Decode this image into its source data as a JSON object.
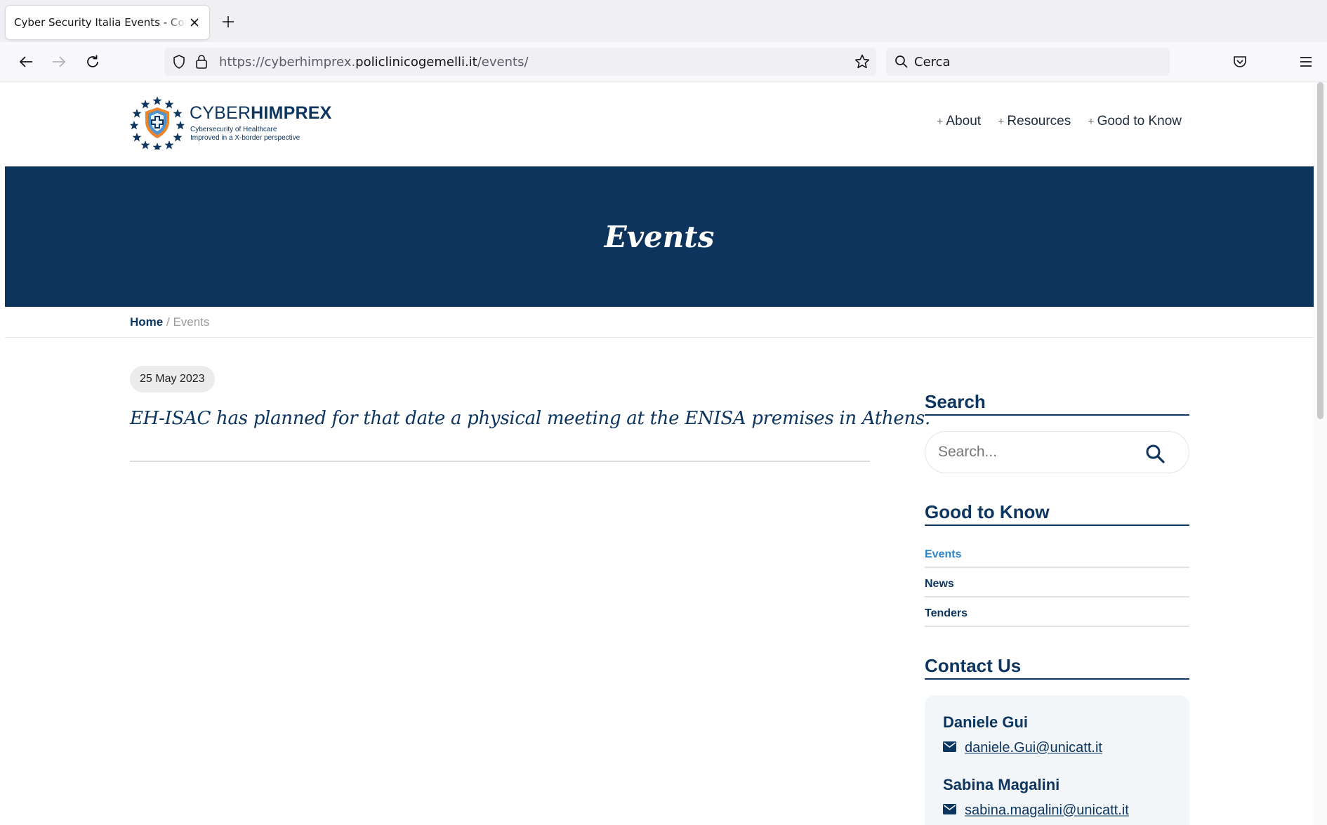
{
  "browser": {
    "tab_title": "Cyber Security Italia Events - Compu",
    "url_prefix": "https://cyberhimprex.",
    "url_host": "policlinicogemelli.it",
    "url_path": "/events/",
    "search_placeholder": "Cerca"
  },
  "site": {
    "logo_word_light": "CYBER",
    "logo_word_bold": "HIMPREX",
    "logo_tagline_1": "Cybersecurity of Healthcare",
    "logo_tagline_2": "Improved in a X-border perspective",
    "nav": [
      {
        "label": "About"
      },
      {
        "label": "Resources"
      },
      {
        "label": "Good to Know"
      }
    ],
    "nav_plus": "+"
  },
  "hero": {
    "title": "Events"
  },
  "breadcrumb": {
    "home": "Home",
    "separator": "/",
    "current": "Events"
  },
  "event": {
    "date": "25 May 2023",
    "title": "EH-ISAC has planned for that date a physical meeting at the ENISA premises in Athens."
  },
  "sidebar": {
    "search_title": "Search",
    "search_placeholder": "Search...",
    "gtk_title": "Good to Know",
    "gtk_items": [
      {
        "label": "Events"
      },
      {
        "label": "News"
      },
      {
        "label": "Tenders"
      }
    ],
    "contact_title": "Contact Us",
    "contacts": [
      {
        "name": "Daniele Gui",
        "email": "daniele.Gui@unicatt.it"
      },
      {
        "name": "Sabina Magalini",
        "email": "sabina.magalini@unicatt.it"
      }
    ]
  },
  "colors": {
    "brand_navy": "#0c345c",
    "link_active": "#2f86c6",
    "accent_orange": "#e9862c"
  }
}
